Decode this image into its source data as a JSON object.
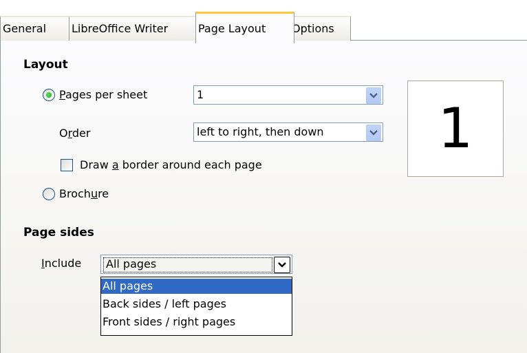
{
  "tabs": [
    {
      "label": "General",
      "active": false
    },
    {
      "label": "LibreOffice Writer",
      "active": false
    },
    {
      "label": "Page Layout",
      "active": true
    },
    {
      "label": "Options",
      "active": false
    }
  ],
  "layout": {
    "heading": "Layout",
    "pages_per_sheet": {
      "pre": "",
      "mnemonic": "P",
      "post": "ages per sheet",
      "selected": true,
      "value": "1"
    },
    "order": {
      "pre": "O",
      "mnemonic": "r",
      "post": "der",
      "value": "left to right, then down"
    },
    "border_checkbox": {
      "pre": "Draw ",
      "mnemonic": "a",
      "post": " border around each page",
      "checked": false
    },
    "brochure": {
      "pre": "Broch",
      "mnemonic": "u",
      "post": "re",
      "selected": false
    },
    "preview_number": "1"
  },
  "page_sides": {
    "heading": "Page sides",
    "include": {
      "pre": "",
      "mnemonic": "I",
      "post": "nclude",
      "value": "All pages"
    },
    "options": [
      "All pages",
      "Back sides / left pages",
      "Front sides / right pages"
    ],
    "selected_option": "All pages"
  },
  "icons": {
    "dropdown_arrow": "chevron-down-icon"
  },
  "colors": {
    "tab_highlight": "#ffc83c",
    "selection": "#316ac5",
    "radio_dot": "#21a121"
  }
}
